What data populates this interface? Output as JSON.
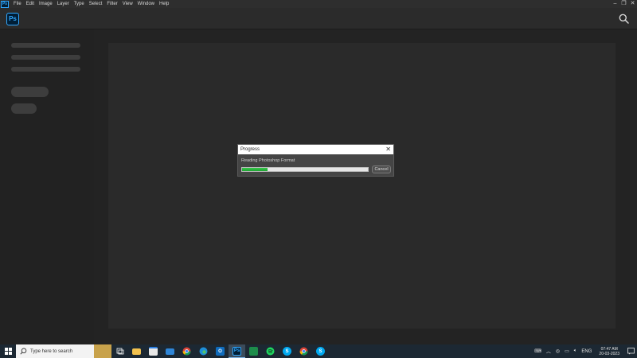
{
  "menubar": {
    "app_icon": "Ps",
    "items": [
      "File",
      "Edit",
      "Image",
      "Layer",
      "Type",
      "Select",
      "Filter",
      "View",
      "Window",
      "Help"
    ],
    "controls": [
      "minimize-icon",
      "restore-icon",
      "close-icon"
    ]
  },
  "header": {
    "logo": "Ps",
    "search_icon": "search-icon"
  },
  "dialog": {
    "title": "Progress",
    "close_glyph": "✕",
    "message": "Reading Photoshop Format",
    "progress": 0.2,
    "progress_color": "#2bb83f",
    "cancel_label": "Cancel"
  },
  "taskbar": {
    "search_placeholder": "Type here to search",
    "pinned": [
      {
        "name": "task-view-icon"
      },
      {
        "name": "file-explorer-icon"
      },
      {
        "name": "store-icon"
      },
      {
        "name": "mail-icon"
      },
      {
        "name": "chrome-icon"
      },
      {
        "name": "edge-icon"
      },
      {
        "name": "outlook-icon"
      },
      {
        "name": "photoshop-icon",
        "label": "Ps",
        "active": true
      },
      {
        "name": "excel-icon"
      },
      {
        "name": "spotify-icon"
      },
      {
        "name": "skype-icon",
        "label": "S"
      },
      {
        "name": "chrome-icon-2"
      },
      {
        "name": "skype-icon-2",
        "label": "S"
      }
    ],
    "tray": {
      "language": "ENG",
      "time": "07:47 AM",
      "date": "20-03-2023"
    }
  }
}
